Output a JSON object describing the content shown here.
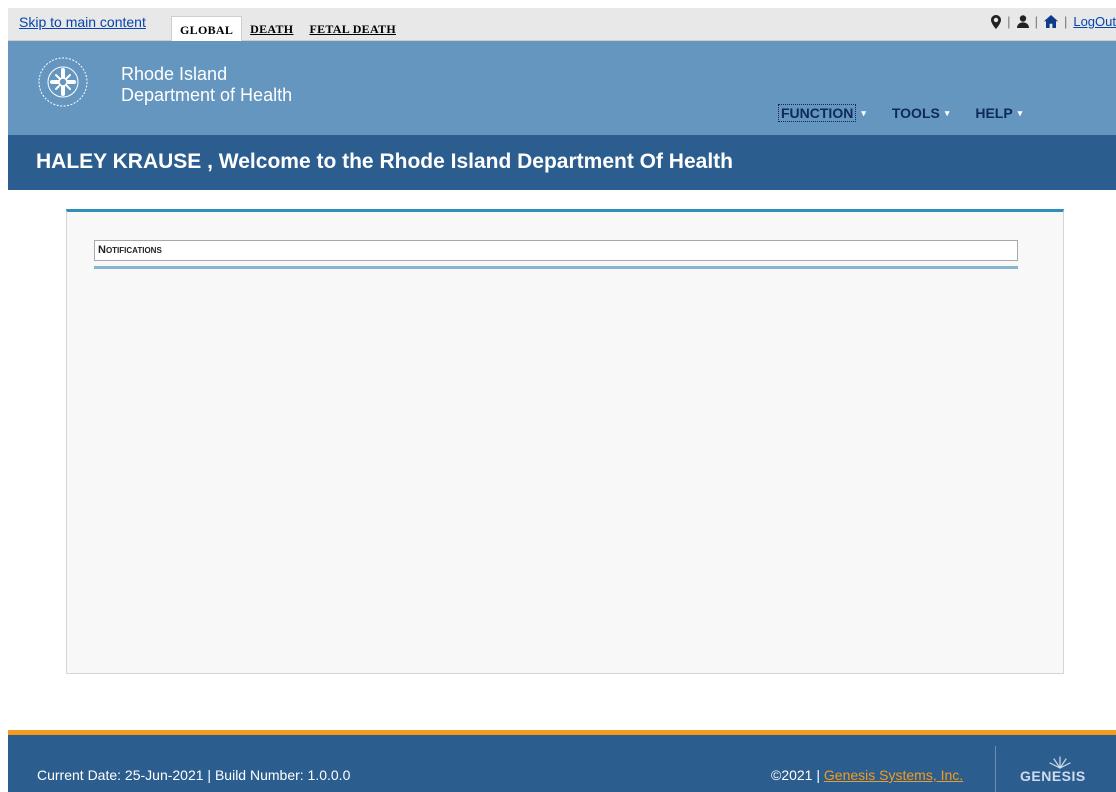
{
  "topbar": {
    "skip_link": "Skip to main content",
    "tabs": [
      {
        "label": "GLOBAL",
        "active": true
      },
      {
        "label": "DEATH",
        "active": false
      },
      {
        "label": "FETAL DEATH",
        "active": false
      }
    ],
    "separator": "|",
    "logout": "LogOut",
    "icons": [
      "map-marker-icon",
      "user-icon",
      "home-icon"
    ]
  },
  "brand": {
    "org_line1": "Rhode Island",
    "org_line2": "Department of Health",
    "seal_icon": "ri-department-of-health-seal",
    "nav": [
      {
        "label": "FUNCTION",
        "caret": "▾"
      },
      {
        "label": "TOOLS",
        "caret": "▾"
      },
      {
        "label": "HELP",
        "caret": "▾"
      }
    ]
  },
  "welcome": {
    "text": "HALEY KRAUSE , Welcome to the Rhode Island Department Of Health"
  },
  "main": {
    "notifications_title": "Notifications"
  },
  "footer": {
    "left_text": "Current Date: 25-Jun-2021 | Build Number: 1.0.0.0",
    "copyright": "©2021 | ",
    "company_link": "Genesis Systems, Inc.",
    "logo_text": "GENESIS"
  },
  "colors": {
    "brand_bar": "#6496bf",
    "welcome_bar": "#2c5d8f",
    "footer_bar": "#2c5d8f",
    "footer_accent": "#f39c1f",
    "panel_accent": "#2f8fb9"
  }
}
